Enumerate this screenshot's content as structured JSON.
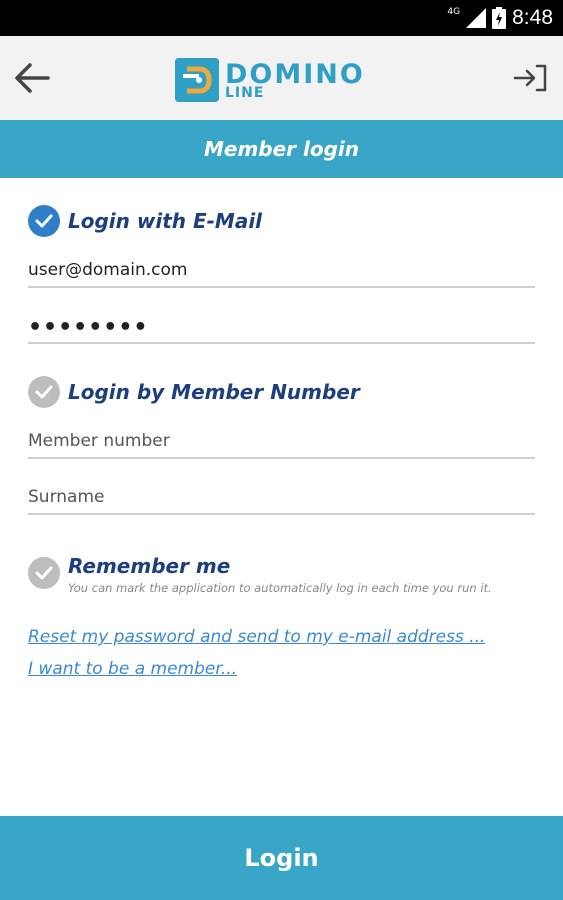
{
  "status_bar": {
    "network": "4G",
    "time": "8:48"
  },
  "header": {
    "logo_main": "DOMINO",
    "logo_sub": "LINE"
  },
  "page": {
    "title": "Member login"
  },
  "email_login": {
    "label": "Login with E-Mail",
    "checked": true,
    "email_value": "user@domain.com",
    "password_mask": "••••••••"
  },
  "member_login": {
    "label": "Login by Member Number",
    "checked": false,
    "member_number_placeholder": "Member number",
    "surname_placeholder": "Surname"
  },
  "remember": {
    "label": "Remember me",
    "checked": false,
    "description": "You can mark the application to automatically log in each time you run it."
  },
  "links": {
    "reset_password": "Reset my password and send to my e-mail address ...",
    "become_member": "I want to be a member..."
  },
  "actions": {
    "login_label": "Login"
  },
  "colors": {
    "accent": "#3aa6c7",
    "heading": "#1d3f7e",
    "link": "#3a8ad0",
    "check_active": "#2f7fc8",
    "check_inactive": "#bdbdbd"
  },
  "icons": {
    "back": "arrow-left-icon",
    "logout": "logout-icon",
    "check": "checkmark-icon"
  }
}
